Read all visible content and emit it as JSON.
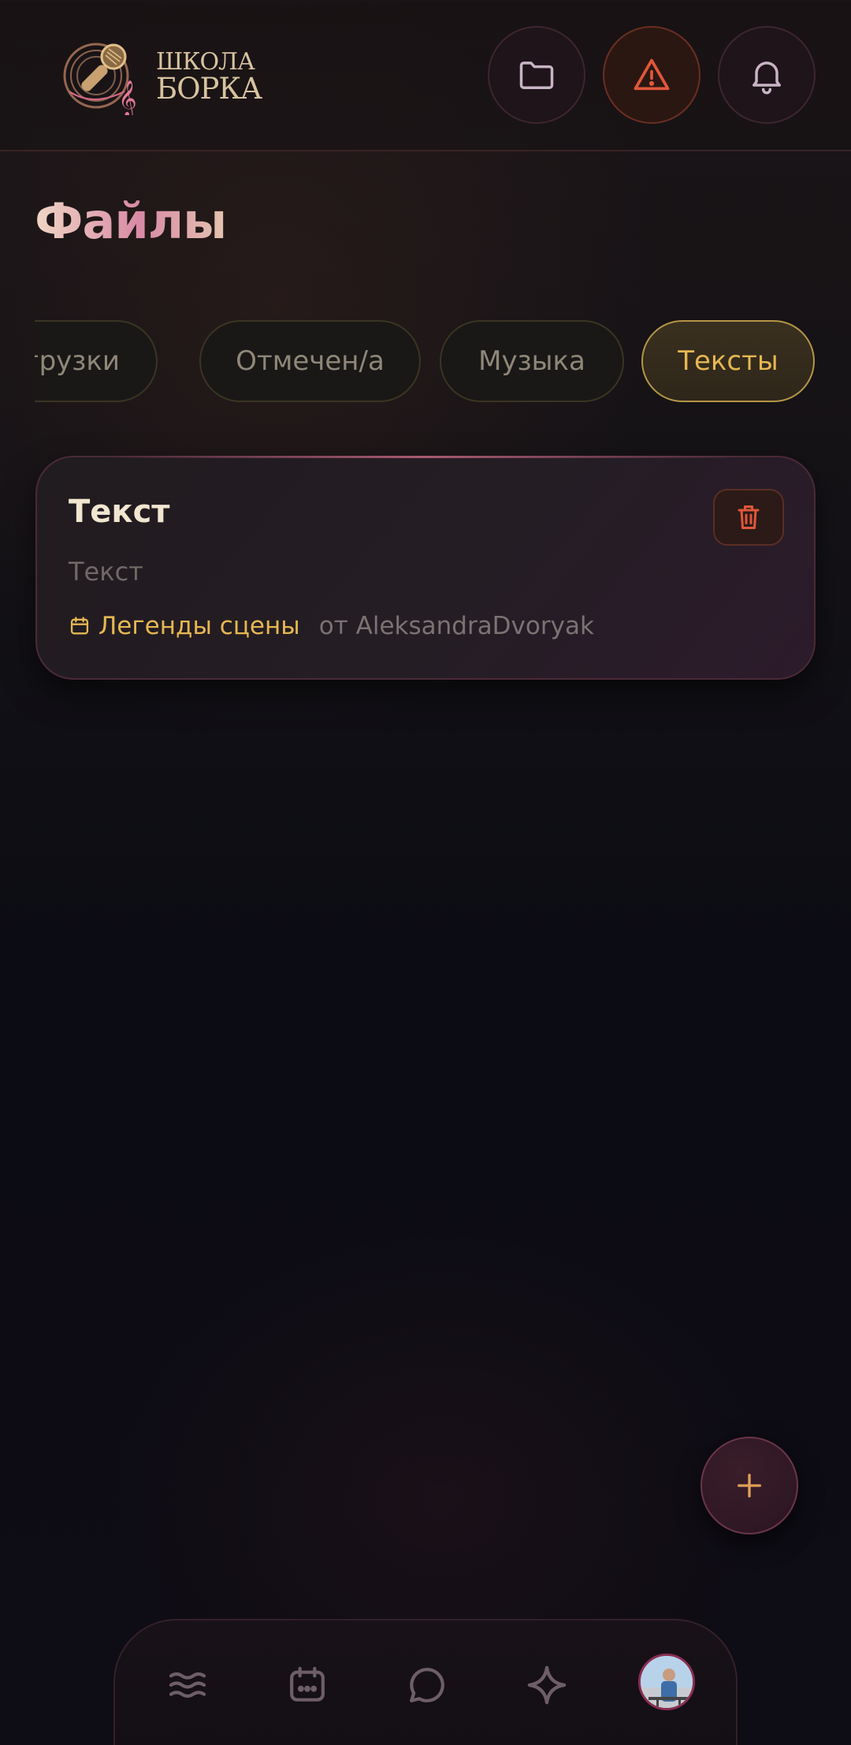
{
  "header": {
    "logo": {
      "line1": "ШКОЛА",
      "line2": "БОРКА"
    },
    "buttons": [
      {
        "icon": "folder-icon"
      },
      {
        "icon": "warning-triangle-icon",
        "color": "#e0573a"
      },
      {
        "icon": "bell-icon"
      }
    ]
  },
  "page": {
    "title": "Файлы"
  },
  "filters": {
    "chips": [
      {
        "label": "Загрузки",
        "active": false
      },
      {
        "label": "Отмечен/а",
        "active": false
      },
      {
        "label": "Музыка",
        "active": false
      },
      {
        "label": "Тексты",
        "active": true
      }
    ]
  },
  "files": [
    {
      "title": "Текст",
      "description": "Текст",
      "event": "Легенды сцены",
      "author": "от AleksandraDvoryak",
      "delete_icon": "trash-icon"
    }
  ],
  "fab": {
    "icon": "plus-icon"
  },
  "bottom_nav": {
    "items": [
      {
        "icon": "waves-menu-icon"
      },
      {
        "icon": "calendar-icon"
      },
      {
        "icon": "chat-bubble-icon"
      },
      {
        "icon": "sparkle-icon"
      },
      {
        "icon": "avatar"
      }
    ]
  },
  "colors": {
    "accent_gold": "#e6b752",
    "accent_pink": "#d88aa6",
    "danger": "#e0573a",
    "background": "#0c0c14"
  }
}
